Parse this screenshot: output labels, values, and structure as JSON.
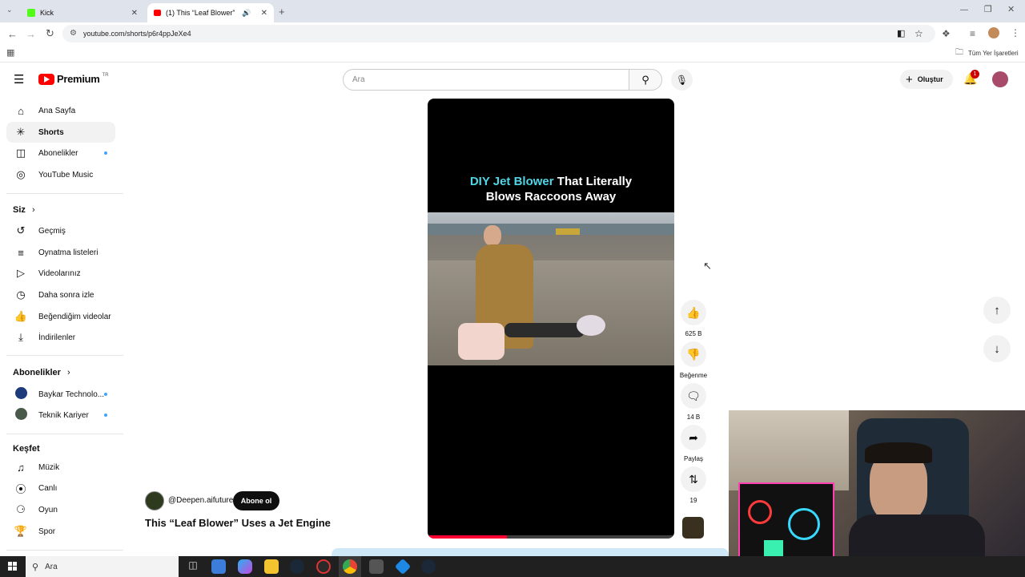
{
  "browser": {
    "tabs": [
      {
        "title": "Kick",
        "active": false
      },
      {
        "title": "(1) This “Leaf Blower” Uses",
        "active": true
      }
    ],
    "url": "youtube.com/shorts/p6r4ppJeXe4",
    "bookmarks_label": "Tüm Yer İşaretleri"
  },
  "youtube": {
    "logo_text": "Premium",
    "logo_region": "TR",
    "search_placeholder": "Ara",
    "create_label": "Oluştur",
    "notification_count": "1",
    "sidebar": {
      "main": [
        {
          "label": "Ana Sayfa",
          "icon": "home-icon"
        },
        {
          "label": "Shorts",
          "icon": "shorts-icon",
          "selected": true
        },
        {
          "label": "Abonelikler",
          "icon": "subscriptions-icon",
          "dot": true
        },
        {
          "label": "YouTube Music",
          "icon": "music-icon"
        }
      ],
      "you_header": "Siz",
      "you": [
        {
          "label": "Geçmiş",
          "icon": "history-icon"
        },
        {
          "label": "Oynatma listeleri",
          "icon": "playlist-icon"
        },
        {
          "label": "Videolarınız",
          "icon": "your-videos-icon"
        },
        {
          "label": "Daha sonra izle",
          "icon": "watch-later-icon"
        },
        {
          "label": "Beğendiğim videolar",
          "icon": "liked-icon"
        },
        {
          "label": "İndirilenler",
          "icon": "downloads-icon"
        }
      ],
      "subs_header": "Abonelikler",
      "subs": [
        {
          "label": "Baykar Technolo...",
          "icon": "channel-avatar",
          "dot": true
        },
        {
          "label": "Teknik Kariyer",
          "icon": "channel-avatar",
          "dot": true
        }
      ],
      "explore_header": "Keşfet",
      "explore": [
        {
          "label": "Müzik",
          "icon": "music-note-icon"
        },
        {
          "label": "Canlı",
          "icon": "live-icon"
        },
        {
          "label": "Oyun",
          "icon": "gaming-icon"
        },
        {
          "label": "Spor",
          "icon": "trophy-icon"
        }
      ]
    },
    "short": {
      "overlay_title_highlight": "DIY Jet Blower",
      "overlay_title_rest1": "That Literally",
      "overlay_title_line2": "Blows Raccoons Away",
      "channel": "@Deepen.aifuture",
      "subscribe_label": "Abone ol",
      "title": "This “Leaf Blower” Uses a Jet Engine",
      "progress": 0.32
    },
    "actions": [
      {
        "name": "like",
        "caption": "625 B"
      },
      {
        "name": "dislike",
        "caption": "Beğenme"
      },
      {
        "name": "comments",
        "caption": "14 B"
      },
      {
        "name": "share",
        "caption": "Paylaş"
      },
      {
        "name": "remix",
        "caption": "19"
      }
    ]
  },
  "taskbar": {
    "search_label": "Ara"
  },
  "colors": {
    "yt_red": "#ff0000",
    "accent_cyan": "#4fd6e6",
    "progress_red": "#ff0033"
  }
}
